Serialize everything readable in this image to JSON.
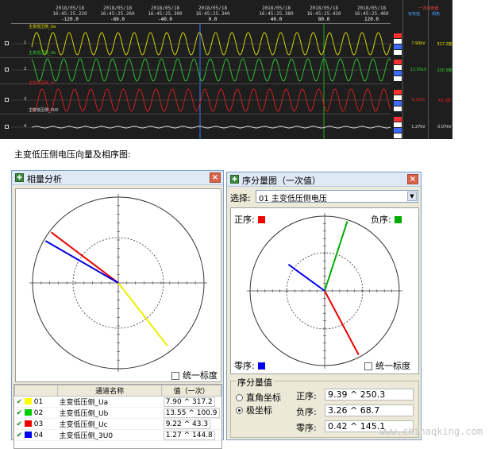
{
  "recorder": {
    "time_labels": [
      {
        "date": "2018/05/18",
        "time": "16:45:25.220",
        "offset": "-120.0"
      },
      {
        "date": "2018/05/18",
        "time": "16:45:25.260",
        "offset": "-80.0"
      },
      {
        "date": "2018/05/18",
        "time": "16:45:25.300",
        "offset": "-40.0"
      },
      {
        "date": "2018/05/18",
        "time": "16:45:25.340",
        "offset": "0.0"
      },
      {
        "date": "2018/05/18",
        "time": "16:45:25.380",
        "offset": "40.0"
      },
      {
        "date": "2018/05/18",
        "time": "16:45:25.420",
        "offset": "80.0"
      },
      {
        "date": "2018/05/18",
        "time": "16:45:25.460",
        "offset": "120.0"
      }
    ],
    "header_right": "一次有效值",
    "header_cols": [
      "有效值",
      "相角"
    ],
    "channels": [
      {
        "num": "1",
        "name": "主变低压侧_Ua",
        "color": "#e6e600",
        "rms": "7.90kV",
        "angle": "317.2度"
      },
      {
        "num": "2",
        "name": "主变低压侧_Ub",
        "color": "#33cc33",
        "rms": "13.55kV",
        "angle": "100.9度"
      },
      {
        "num": "3",
        "name": "主变低压侧_Uc",
        "color": "#e02020",
        "rms": "9.22kV",
        "angle": "43.3度"
      },
      {
        "num": "4",
        "name": "主变低压侧_3U0",
        "color": "#e0e0e0",
        "rms": "1.27kV",
        "angle": "0.07kV"
      }
    ]
  },
  "caption": "主变低压侧电压向量及相序图:",
  "phasor_window": {
    "title": "相量分析",
    "unify_scale": "统一标度",
    "table": {
      "col_name": "通道名称",
      "col_value": "值（一次）",
      "rows": [
        {
          "idx": "01",
          "name": "主变低压侧_Ua",
          "color": "#ffff00",
          "value": "7.90 ^ 317.2",
          "magnitude": 7.9,
          "angle": 317.2
        },
        {
          "idx": "02",
          "name": "主变低压侧_Ub",
          "color": "#00cc00",
          "value": "13.55 ^ 100.9",
          "magnitude": 13.55,
          "angle": 100.9
        },
        {
          "idx": "03",
          "name": "主变低压侧_Uc",
          "color": "#ee0000",
          "value": "9.22 ^ 43.3",
          "magnitude": 9.22,
          "angle": 43.3
        },
        {
          "idx": "04",
          "name": "主变低压侧_3U0",
          "color": "#0000ee",
          "value": "1.27 ^ 144.8",
          "magnitude": 1.27,
          "angle": 144.8
        }
      ]
    }
  },
  "sequence_window": {
    "title": "序分量图（一次值）",
    "select_label": "选择:",
    "select_value": "01 主变低压侧电压",
    "positive_label": "正序:",
    "negative_label": "负序:",
    "zero_label": "零序:",
    "positive_color": "#ee0000",
    "negative_color": "#00aa00",
    "zero_color": "#0000ee",
    "unify_scale": "统一标度",
    "group_title": "序分量值",
    "radio_rect": "直角坐标",
    "radio_polar": "极坐标",
    "values": {
      "positive": "9.39 ^ 250.3",
      "negative": "3.26 ^ 68.7",
      "zero": "0.42 ^ 145.1"
    }
  },
  "watermark": "www.chinaqking.com"
}
